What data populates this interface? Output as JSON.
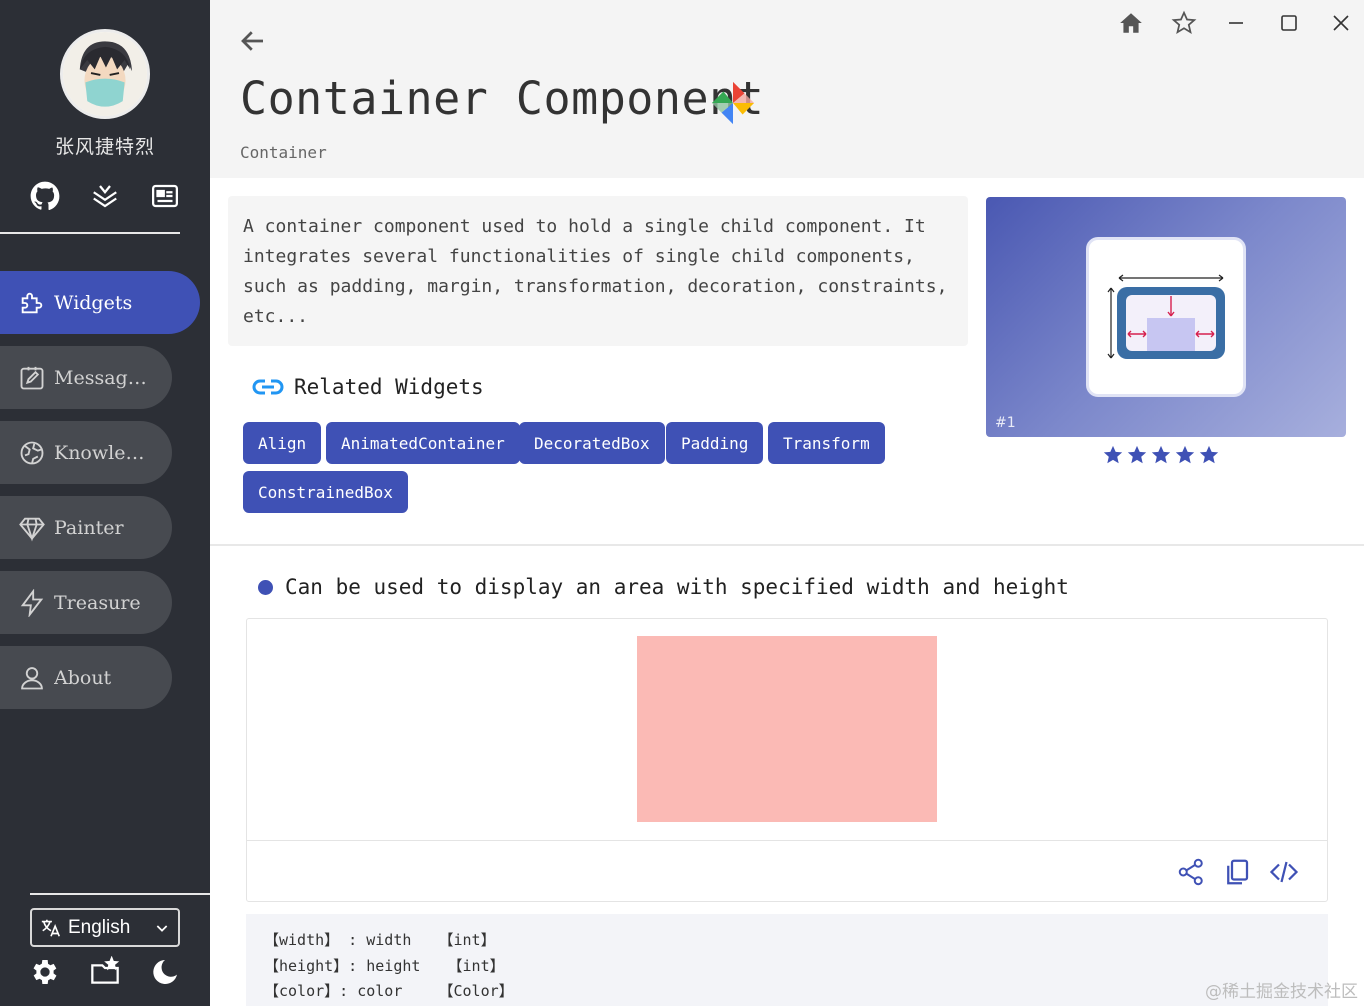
{
  "sidebar": {
    "username": "张风捷特烈",
    "social_icons": [
      "github-icon",
      "layers-icon",
      "news-icon"
    ],
    "nav": [
      {
        "label": "Widgets",
        "icon": "puzzle-icon",
        "active": true
      },
      {
        "label": "Message…",
        "icon": "edit-note-icon",
        "active": false
      },
      {
        "label": "Knowledge",
        "icon": "globe-icon",
        "active": false
      },
      {
        "label": "Painter",
        "icon": "diamond-icon",
        "active": false
      },
      {
        "label": "Treasure",
        "icon": "lightning-icon",
        "active": false
      },
      {
        "label": "About",
        "icon": "person-icon",
        "active": false
      }
    ],
    "language": "English",
    "bottom_icons": [
      "settings-icon",
      "folder-star-icon",
      "dark-mode-icon"
    ]
  },
  "header": {
    "title": "Container Component",
    "subtitle": "Container",
    "window_icons": [
      "home-icon",
      "star-outline-icon",
      "minimize-icon",
      "maximize-icon",
      "close-icon"
    ]
  },
  "description": "A container component used to hold a single child component. It integrates several functionalities of single child components, such as padding, margin, transformation, decoration, constraints, etc...",
  "related": {
    "title": "Related Widgets",
    "tags": [
      "Align",
      "AnimatedContainer",
      "DecoratedBox",
      "Padding",
      "Transform",
      "ConstrainedBox"
    ]
  },
  "preview": {
    "rank": "#1",
    "rating": 5
  },
  "demo": {
    "title": "Can be used to display an area with specified width and height",
    "box_color": "#fbbab5",
    "actions": [
      "share-icon",
      "copy-icon",
      "code-icon"
    ]
  },
  "params": [
    "【width】 : width   【int】",
    "【height】: height   【int】",
    "【color】: color    【Color】"
  ],
  "watermark": "@稀土掘金技术社区",
  "colors": {
    "accent": "#3f51b5",
    "sidebar_bg": "#2c2f36",
    "nav_item_bg": "#474a50"
  }
}
